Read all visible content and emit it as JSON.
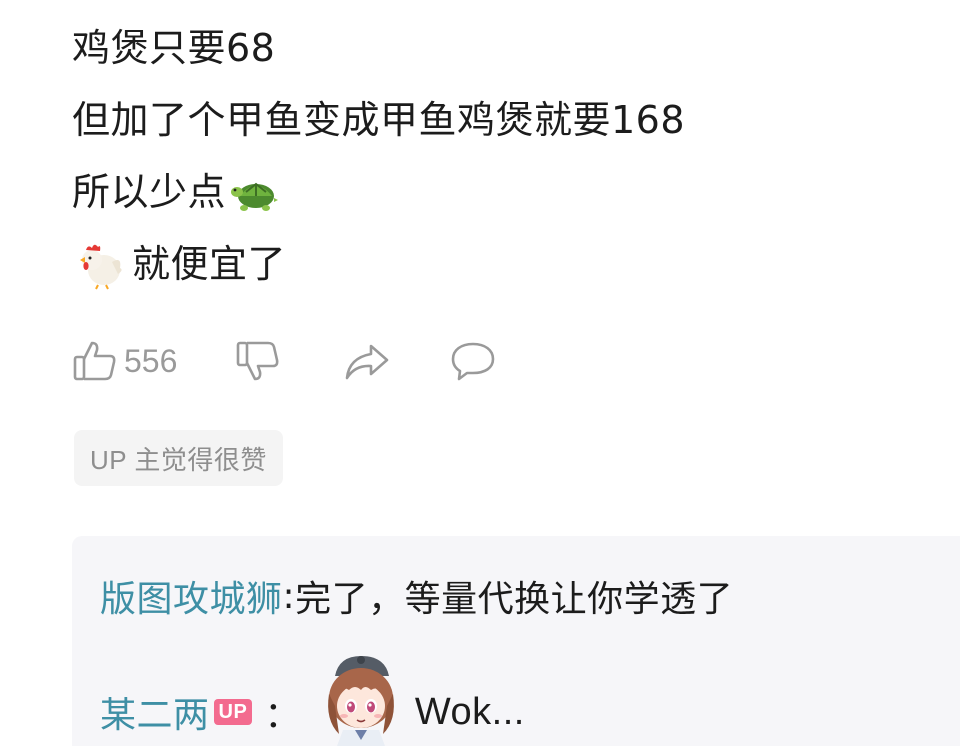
{
  "comment": {
    "lines": [
      "鸡煲只要68",
      "但加了个甲鱼变成甲鱼鸡煲就要168",
      "所以少点",
      "就便宜了"
    ],
    "emojis": {
      "line3_after": "turtle-icon",
      "line4_before": "chicken-icon"
    }
  },
  "actions": {
    "like_count": "556",
    "icons": [
      "thumbs-up-icon",
      "thumbs-down-icon",
      "share-icon",
      "reply-icon"
    ]
  },
  "up_badge": "UP 主觉得很赞",
  "replies": [
    {
      "username": "版图攻城狮",
      "colon": ":",
      "text": " 完了，等量代换让你学透了"
    },
    {
      "username": "某二两",
      "badge": "UP",
      "colon": "：",
      "sticker": "anime-girl-sticker-icon",
      "text": "Wok..."
    }
  ],
  "colors": {
    "username": "#3e8fa5",
    "up_tag": "#f36b8f",
    "icon_gray": "#9a9a9a",
    "reply_bg": "#f6f6f9"
  }
}
